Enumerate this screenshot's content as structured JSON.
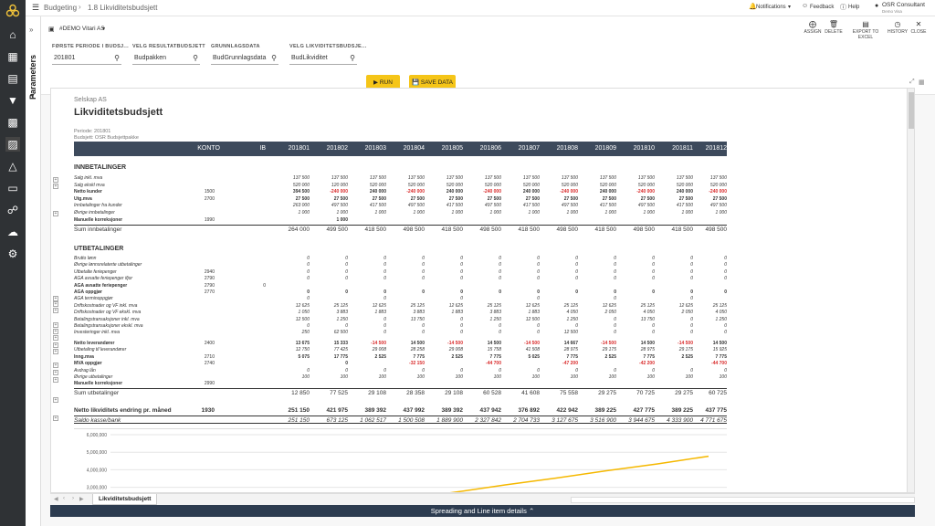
{
  "topbar": {
    "app": "Budgeting",
    "page": "1.8 Likviditetsbudsjett",
    "notifications": "Notifications",
    "feedback": "Feedback",
    "help": "Help",
    "user_name": "OSR Consultant",
    "user_sub": "Demo Visa"
  },
  "company_select": "#DEMO Vitari AS",
  "sidebar_label": "Parameters",
  "toolbar": {
    "assign": "ASSIGN",
    "delete": "DELETE",
    "export": "EXPORT TO EXCEL",
    "history": "HISTORY",
    "close": "CLOSE"
  },
  "params": [
    {
      "label": "FØRSTE PERIODE I BUDSJ...",
      "value": "201801"
    },
    {
      "label": "VELG RESULTATBUDSJETT",
      "value": "Budpakken"
    },
    {
      "label": "GRUNNLAGSDATA",
      "value": "BudGrunnlagsdata"
    },
    {
      "label": "VELG LIKVIDITETSBUDSJE...",
      "value": "BudLikviditet"
    }
  ],
  "buttons": {
    "run": "RUN",
    "save": "SAVE DATA"
  },
  "report": {
    "company": "Selskap AS",
    "title": "Likviditetsbudsjett",
    "periode": "Periode:   201801",
    "budsjett": "Budsjett: OSR Budsjettpakke",
    "col_konto": "KONTO",
    "col_ib": "IB",
    "periods": [
      "201801",
      "201802",
      "201803",
      "201804",
      "201805",
      "201806",
      "201807",
      "201808",
      "201809",
      "201810",
      "201811",
      "201812"
    ],
    "innbetalinger_title": "INNBETALINGER",
    "innbetalinger": [
      {
        "label": "Salg inkl. mva",
        "konto": "",
        "values": [
          "137 500",
          "137 500",
          "137 500",
          "137 500",
          "137 500",
          "137 500",
          "137 500",
          "137 500",
          "137 500",
          "137 500",
          "137 500",
          "137 500"
        ]
      },
      {
        "label": "Salg ekskl mva",
        "konto": "",
        "values": [
          "520 000",
          "120 000",
          "520 000",
          "520 000",
          "520 000",
          "520 000",
          "520 000",
          "520 000",
          "520 000",
          "520 000",
          "520 000",
          "520 000"
        ]
      },
      {
        "label": "Netto kunder",
        "konto": "1500",
        "bold": true,
        "values": [
          "394 500",
          "-240 000",
          "240 000",
          "-240 000",
          "240 000",
          "-240 000",
          "240 000",
          "-240 000",
          "240 000",
          "-240 000",
          "240 000",
          "-240 000"
        ]
      },
      {
        "label": "Utg.mva",
        "konto": "2700",
        "bold": true,
        "values": [
          "27 500",
          "27 500",
          "27 500",
          "27 500",
          "27 500",
          "27 500",
          "27 500",
          "27 500",
          "27 500",
          "27 500",
          "27 500",
          "27 500"
        ]
      },
      {
        "label": "Innbetalinger fra kunder",
        "konto": "",
        "values": [
          "263 000",
          "497 500",
          "417 500",
          "497 500",
          "417 500",
          "497 500",
          "417 500",
          "497 500",
          "417 500",
          "497 500",
          "417 500",
          "497 500"
        ]
      },
      {
        "label": "Øvrige innbetalinger",
        "konto": "",
        "values": [
          "1 000",
          "1 000",
          "1 000",
          "1 000",
          "1 000",
          "1 000",
          "1 000",
          "1 000",
          "1 000",
          "1 000",
          "1 000",
          "1 000"
        ]
      },
      {
        "label": "Manuelle korreksjoner",
        "konto": "1990",
        "bold": true,
        "values": [
          "",
          "1 000",
          "",
          "",
          "",
          "",
          "",
          "",
          "",
          "",
          "",
          ""
        ]
      }
    ],
    "sum_inn": {
      "label": "Sum innbetalinger",
      "values": [
        "264 000",
        "499 500",
        "418 500",
        "498 500",
        "418 500",
        "498 500",
        "418 500",
        "498 500",
        "418 500",
        "498 500",
        "418 500",
        "498 500"
      ]
    },
    "utbetalinger_title": "UTBETALINGER",
    "utbetalinger": [
      {
        "label": "Brutto lønn",
        "konto": "",
        "ib": "",
        "values": [
          "0",
          "0",
          "0",
          "0",
          "0",
          "0",
          "0",
          "0",
          "0",
          "0",
          "0",
          "0"
        ]
      },
      {
        "label": "Øvrige lønnsrelaterte utbetalinger",
        "konto": "",
        "ib": "",
        "values": [
          "0",
          "0",
          "0",
          "0",
          "0",
          "0",
          "0",
          "0",
          "0",
          "0",
          "0",
          "0"
        ]
      },
      {
        "label": "Utbetalte feriepenger",
        "konto": "2940",
        "ib": "",
        "values": [
          "0",
          "0",
          "0",
          "0",
          "0",
          "0",
          "0",
          "0",
          "0",
          "0",
          "0",
          "0"
        ]
      },
      {
        "label": "AGA avsatte feriepenger ifjor",
        "konto": "2790",
        "ib": "",
        "values": [
          "0",
          "0",
          "0",
          "0",
          "0",
          "0",
          "0",
          "0",
          "0",
          "0",
          "0",
          "0"
        ]
      },
      {
        "label": "AGA avsatte feriepenger",
        "konto": "2790",
        "ib": "0",
        "bold": true,
        "values": [
          "",
          "",
          "",
          "",
          "",
          "",
          "",
          "",
          "",
          "",
          "",
          ""
        ]
      },
      {
        "label": "AGA oppgjør",
        "konto": "2770",
        "ib": "",
        "bold": true,
        "values": [
          "0",
          "0",
          "0",
          "0",
          "0",
          "0",
          "0",
          "0",
          "0",
          "0",
          "0",
          "0"
        ]
      },
      {
        "label": "AGA terminoppgjør",
        "konto": "",
        "ib": "",
        "values": [
          "0",
          "",
          "0",
          "",
          "0",
          "",
          "0",
          "",
          "0",
          "",
          "0",
          ""
        ]
      },
      {
        "label": "Driftskostnader og VF inkl. mva",
        "konto": "",
        "ib": "",
        "values": [
          "12 625",
          "25 125",
          "12 625",
          "25 125",
          "12 625",
          "25 125",
          "12 625",
          "25 125",
          "12 625",
          "25 125",
          "12 625",
          "25 125"
        ]
      },
      {
        "label": "Driftskostnader og VF ekskl. mva",
        "konto": "",
        "ib": "",
        "values": [
          "1 050",
          "3 883",
          "1 883",
          "3 883",
          "1 883",
          "3 883",
          "1 883",
          "4 050",
          "2 050",
          "4 050",
          "2 050",
          "4 050"
        ]
      },
      {
        "label": "Betalingstransaksjoner inkl. mva",
        "konto": "",
        "ib": "",
        "values": [
          "12 500",
          "1 250",
          "0",
          "13 750",
          "0",
          "1 250",
          "12 500",
          "1 250",
          "0",
          "13 750",
          "0",
          "1 250"
        ]
      },
      {
        "label": "Betalingstransaksjoner ekskl. mva",
        "konto": "",
        "ib": "",
        "values": [
          "0",
          "0",
          "0",
          "0",
          "0",
          "0",
          "0",
          "0",
          "0",
          "0",
          "0",
          "0"
        ]
      },
      {
        "label": "Investeringer inkl. mva",
        "konto": "",
        "ib": "",
        "values": [
          "250",
          "62 500",
          "0",
          "0",
          "0",
          "0",
          "0",
          "12 500",
          "0",
          "0",
          "0",
          "0"
        ]
      }
    ],
    "utbetalinger2": [
      {
        "label": "Netto leverandører",
        "konto": "2400",
        "bold": true,
        "values": [
          "13 675",
          "15 333",
          "-14 500",
          "14 500",
          "-14 500",
          "14 500",
          "-14 500",
          "14 667",
          "-14 500",
          "14 500",
          "-14 500",
          "14 500"
        ]
      },
      {
        "label": "Utbetaling til leverandører",
        "konto": "",
        "values": [
          "12 750",
          "77 425",
          "29 008",
          "28 258",
          "29 008",
          "15 758",
          "41 508",
          "28 975",
          "29 175",
          "28 975",
          "29 175",
          "15 925"
        ]
      },
      {
        "label": "Inng.mva",
        "konto": "2710",
        "bold": true,
        "values": [
          "5 075",
          "17 775",
          "2 525",
          "7 775",
          "2 525",
          "7 775",
          "5 025",
          "7 775",
          "2 525",
          "7 775",
          "2 525",
          "7 775"
        ]
      },
      {
        "label": "MVA oppgjør",
        "konto": "2740",
        "bold": true,
        "values": [
          "",
          "0",
          "",
          "-32 150",
          "",
          "-44 700",
          "",
          "-47 200",
          "",
          "-42 200",
          "",
          "-44 700"
        ]
      },
      {
        "label": "Avdrag lån",
        "konto": "",
        "values": [
          "0",
          "0",
          "0",
          "0",
          "0",
          "0",
          "0",
          "0",
          "0",
          "0",
          "0",
          "0"
        ]
      },
      {
        "label": "Øvrige utbetalinger",
        "konto": "",
        "values": [
          "100",
          "100",
          "100",
          "100",
          "100",
          "100",
          "100",
          "100",
          "100",
          "100",
          "100",
          "100"
        ]
      },
      {
        "label": "Manuelle korreksjoner",
        "konto": "2990",
        "bold": true,
        "values": [
          "",
          "",
          "",
          "",
          "",
          "",
          "",
          "",
          "",
          "",
          "",
          ""
        ]
      }
    ],
    "sum_ut": {
      "label": "Sum utbetalinger",
      "values": [
        "12 850",
        "77 525",
        "29 108",
        "28 358",
        "29 108",
        "60 528",
        "41 608",
        "75 558",
        "29 275",
        "70 725",
        "29 275",
        "60 725"
      ]
    },
    "netto": {
      "label": "Netto likviditets endring pr. måned",
      "konto": "1930",
      "values": [
        "251 150",
        "421 975",
        "389 392",
        "437 992",
        "389 392",
        "437 942",
        "376 892",
        "422 942",
        "389 225",
        "427 775",
        "389 225",
        "437 775"
      ]
    },
    "saldo": {
      "label": "Saldo kasse/bank",
      "values": [
        "251 150",
        "673 125",
        "1 062 517",
        "1 500 508",
        "1 889 900",
        "2 327 842",
        "2 704 733",
        "3 127 675",
        "3 516 900",
        "3 944 675",
        "4 333 900",
        "4 771 675"
      ]
    }
  },
  "chart_data": {
    "type": "line",
    "yticks": [
      "6,000,000",
      "5,000,000",
      "4,000,000",
      "3,000,000"
    ],
    "ylim": [
      3000000,
      6000000
    ],
    "series": [
      {
        "values": [
          251150,
          673125,
          1062517,
          1500508,
          1889900,
          2327842,
          2704733,
          3127675,
          3516900,
          3944675,
          4333900,
          4771675
        ]
      }
    ],
    "color": "#f5b800"
  },
  "sheet_tab": "Likviditetsbudsjett",
  "footer": "Spreading and Line item details"
}
